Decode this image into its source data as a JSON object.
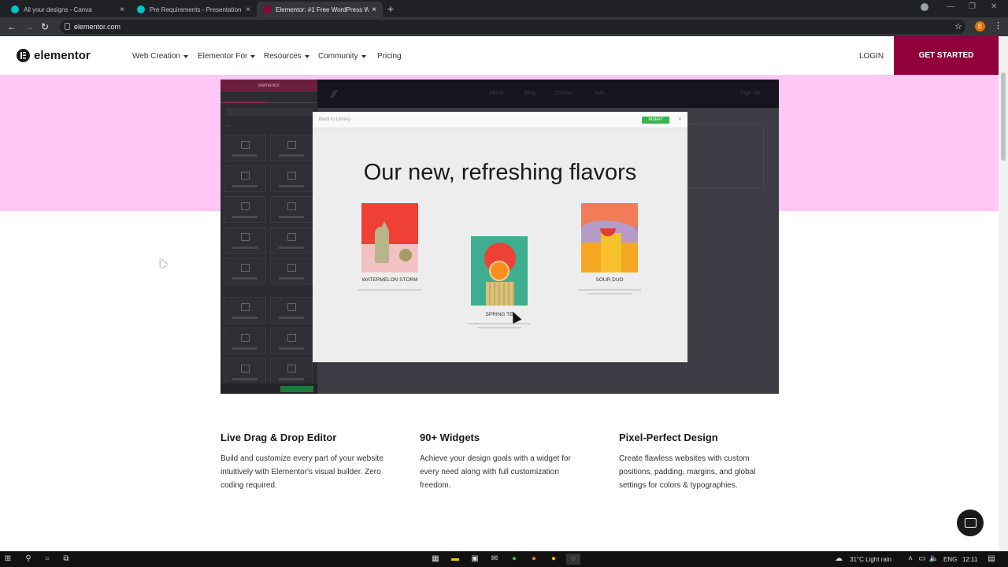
{
  "browser": {
    "tabs": [
      {
        "title": "All your designs - Canva",
        "color": "#00c4cc",
        "active": false
      },
      {
        "title": "Pre Requirements - Presentation",
        "color": "#00c4cc",
        "active": false
      },
      {
        "title": "Elementor: #1 Free WordPress W",
        "color": "#92003b",
        "active": true
      }
    ],
    "new_tab": "+",
    "url": "elementor.com",
    "profile_initial": "E"
  },
  "site": {
    "logo": "elementor",
    "nav": [
      {
        "label": "Web Creation",
        "caret": true
      },
      {
        "label": "Elementor For",
        "caret": true
      },
      {
        "label": "Resources",
        "caret": true
      },
      {
        "label": "Community",
        "caret": true
      },
      {
        "label": "Pricing",
        "caret": false
      }
    ],
    "login": "LOGIN",
    "cta": "GET STARTED",
    "brand_color": "#92003b",
    "band_color": "#ffc7f6"
  },
  "editor_preview": {
    "panel_title": "elementor",
    "top_links": [
      "About",
      "Blog",
      "Contact",
      "Info"
    ],
    "signup": "Sign Up",
    "modal": {
      "back": "Back to Library",
      "insert": "INSERT",
      "title": "Our new, refreshing flavors",
      "cards": [
        {
          "name": "WATERMELON STORM"
        },
        {
          "name": "SPRING TE"
        },
        {
          "name": "SOUR DUO"
        }
      ]
    }
  },
  "features": [
    {
      "title": "Live Drag & Drop Editor",
      "text": "Build and customize every part of your website intuitively with Elementor's visual builder. Zero coding required."
    },
    {
      "title": "90+ Widgets",
      "text": "Achieve your design goals with a widget for every need along with full customization freedom."
    },
    {
      "title": "Pixel-Perfect Design",
      "text": "Create flawless websites with custom positions, padding, margins, and global settings for colors & typographies."
    }
  ],
  "taskbar": {
    "weather": "31°C  Light rain",
    "language": "ENG",
    "time": "12:11"
  }
}
